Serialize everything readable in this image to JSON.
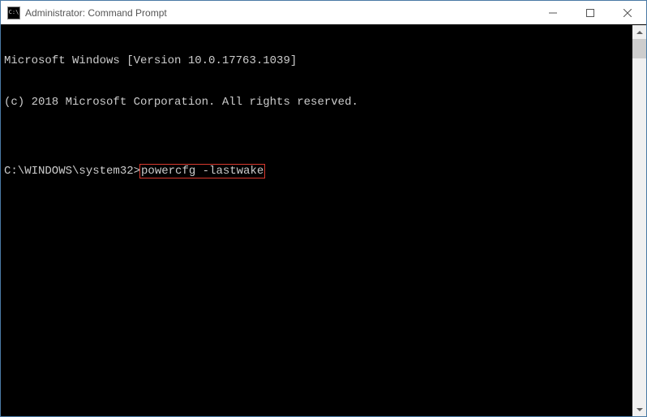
{
  "window": {
    "title": "Administrator: Command Prompt",
    "icon_glyph": "C:\\"
  },
  "terminal": {
    "line1": "Microsoft Windows [Version 10.0.17763.1039]",
    "line2": "(c) 2018 Microsoft Corporation. All rights reserved.",
    "blank": "",
    "prompt": "C:\\WINDOWS\\system32>",
    "command": "powercfg -lastwake"
  }
}
